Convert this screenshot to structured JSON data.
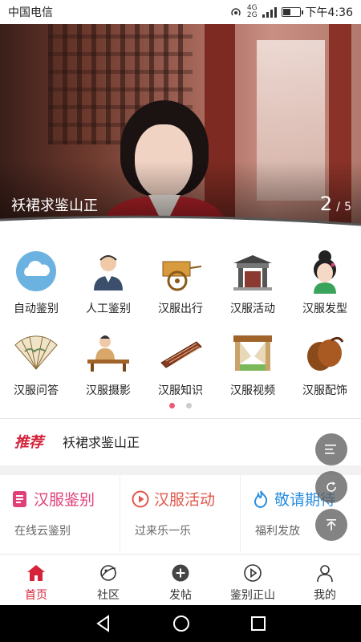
{
  "status_bar": {
    "carrier": "中国电信",
    "network_top": "4G",
    "network_bottom": "2G",
    "time": "下午4:36"
  },
  "banner": {
    "caption": "袄裙求鉴山正",
    "page_current": "2",
    "page_separator": "/",
    "page_total": "5"
  },
  "grid": {
    "items": [
      {
        "label": "自动鉴别",
        "icon": "cloud-icon"
      },
      {
        "label": "人工鉴别",
        "icon": "customer-service-icon"
      },
      {
        "label": "汉服出行",
        "icon": "cart-icon"
      },
      {
        "label": "汉服活动",
        "icon": "pavilion-icon"
      },
      {
        "label": "汉服发型",
        "icon": "hairstyle-girl-icon"
      },
      {
        "label": "汉服问答",
        "icon": "folding-fan-icon"
      },
      {
        "label": "汉服摄影",
        "icon": "scholar-desk-icon"
      },
      {
        "label": "汉服知识",
        "icon": "guzheng-icon"
      },
      {
        "label": "汉服视频",
        "icon": "stage-icon"
      },
      {
        "label": "汉服配饰",
        "icon": "castanets-icon"
      }
    ],
    "page_count": 2,
    "active_page": 1
  },
  "recommend": {
    "tag": "推荐",
    "text": "袄裙求鉴山正"
  },
  "cards": [
    {
      "title": "汉服鉴别",
      "subtitle": "在线云鉴别",
      "color": "#e0407a",
      "icon": "document-icon"
    },
    {
      "title": "汉服活动",
      "subtitle": "过来乐一乐",
      "color": "#e2574c",
      "icon": "play-circle-icon"
    },
    {
      "title": "敬请期待",
      "subtitle": "福利发放",
      "color": "#2b8fe0",
      "icon": "flame-icon"
    }
  ],
  "tabbar": {
    "items": [
      {
        "label": "首页",
        "active": true
      },
      {
        "label": "社区",
        "active": false
      },
      {
        "label": "发帖",
        "active": false
      },
      {
        "label": "鉴别正山",
        "active": false
      },
      {
        "label": "我的",
        "active": false
      }
    ]
  },
  "colors": {
    "accent": "#d5233a",
    "dot_active": "#ec5b72"
  }
}
